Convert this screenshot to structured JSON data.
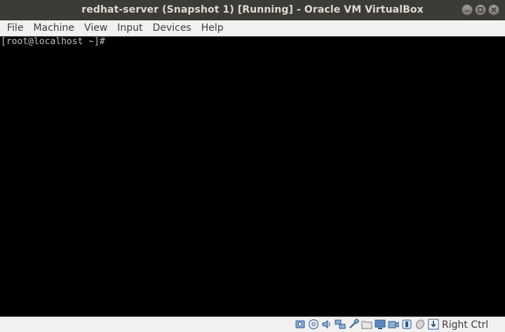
{
  "window": {
    "title": "redhat-server (Snapshot 1) [Running] - Oracle VM VirtualBox"
  },
  "menu": {
    "items": [
      {
        "label": "File"
      },
      {
        "label": "Machine"
      },
      {
        "label": "View"
      },
      {
        "label": "Input"
      },
      {
        "label": "Devices"
      },
      {
        "label": "Help"
      }
    ]
  },
  "console": {
    "prompt": "[root@localhost ~]#"
  },
  "statusbar": {
    "icons": [
      "hard-disk-icon",
      "optical-drive-icon",
      "audio-icon",
      "network-icon",
      "usb-icon",
      "shared-folders-icon",
      "display-icon",
      "video-capture-icon",
      "vrde-icon",
      "mouse-integration-icon",
      "keyboard-capture-icon"
    ],
    "host_key": "Right Ctrl"
  },
  "colors": {
    "titlebar": "#3c3b37",
    "menubar": "#f2f1f0",
    "screen": "#000000",
    "console_text": "#c0c0c0"
  }
}
